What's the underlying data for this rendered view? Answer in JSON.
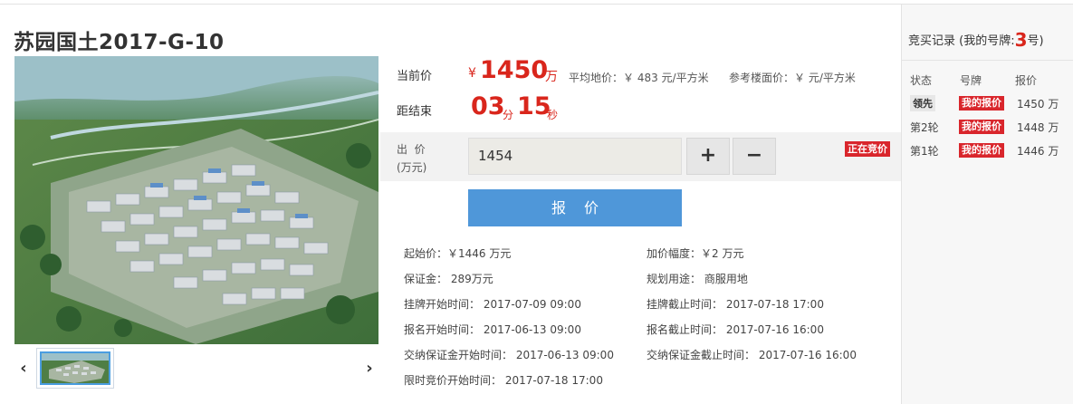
{
  "lot": {
    "title": "苏园国土2017-G-10"
  },
  "price": {
    "label": "当前价",
    "currency": "¥",
    "value": "1450",
    "unit": "万",
    "avg_land_price": "平均地价：￥  483 元/平方米",
    "ref_floor_price": "参考楼面价：￥  元/平方米"
  },
  "countdown": {
    "label": "距结束",
    "minutes": "03",
    "minutes_unit": "分",
    "seconds": "15",
    "seconds_unit": "秒"
  },
  "bid": {
    "label_line1": "出  价",
    "label_line2": "(万元)",
    "input_value": "1454",
    "plus": "+",
    "minus": "−",
    "status_badge": "正在竞价",
    "submit_label": "报价"
  },
  "details": {
    "start_price": "起始价：￥1446  万元",
    "increment": "加价幅度：￥2  万元",
    "deposit": "保证金：  289万元",
    "land_use": "规划用途：  商服用地",
    "listing_start": "挂牌开始时间：  2017-07-09 09:00",
    "listing_end": "挂牌截止时间：  2017-07-18 17:00",
    "signup_start": "报名开始时间：  2017-06-13 09:00",
    "signup_end": "报名截止时间：  2017-07-16 16:00",
    "deposit_start": "交纳保证金开始时间：  2017-06-13 09:00",
    "deposit_end": "交纳保证金截止时间：  2017-07-16 16:00",
    "timed_bid_start": "限时竞价开始时间：  2017-07-18 17:00"
  },
  "gallery": {
    "prev": "‹",
    "next": "›"
  },
  "sidebar": {
    "title_prefix": "竞买记录 (我的号牌:",
    "paddle_no": "3",
    "title_suffix": "号)",
    "headers": {
      "status": "状态",
      "paddle": "号牌",
      "bid": "报价"
    },
    "records": [
      {
        "status": "领先",
        "paddle": "我的报价",
        "bid": "1450 万"
      },
      {
        "status": "第2轮",
        "paddle": "我的报价",
        "bid": "1448 万"
      },
      {
        "status": "第1轮",
        "paddle": "我的报价",
        "bid": "1446 万"
      }
    ]
  },
  "colors": {
    "accent_red": "#d9261c",
    "submit_blue": "#4f97d9"
  }
}
